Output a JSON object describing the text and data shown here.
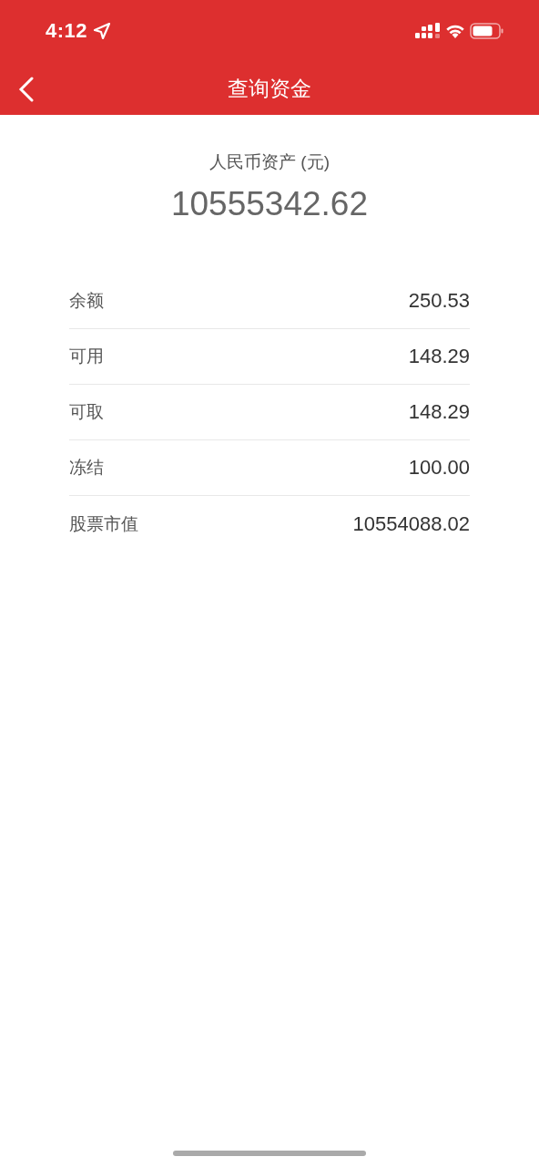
{
  "status_bar": {
    "time": "4:12"
  },
  "nav_bar": {
    "title": "查询资金"
  },
  "summary": {
    "label": "人民币资产 (元)",
    "total": "10555342.62"
  },
  "funds": [
    {
      "label": "余额",
      "value": "250.53"
    },
    {
      "label": "可用",
      "value": "148.29"
    },
    {
      "label": "可取",
      "value": "148.29"
    },
    {
      "label": "冻结",
      "value": "100.00"
    },
    {
      "label": "股票市值",
      "value": "10554088.02"
    }
  ]
}
